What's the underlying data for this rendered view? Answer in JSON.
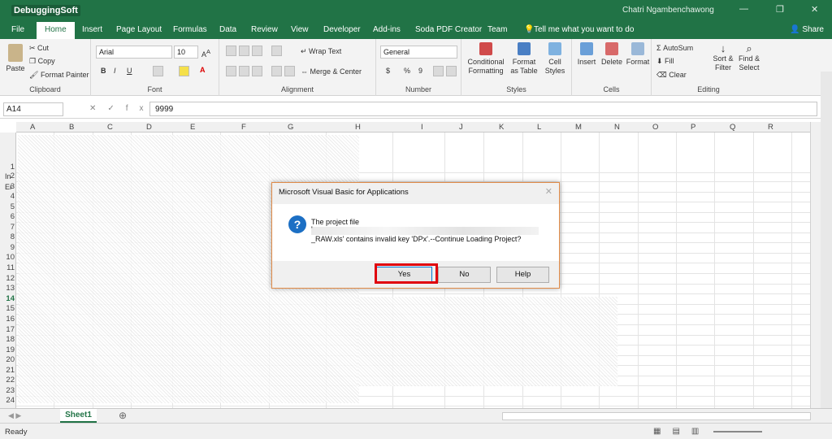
{
  "titlebar": {
    "logo": "DebuggingSoft",
    "user": "Chatri Ngambenchawong",
    "min": "—",
    "restore": "❐",
    "close": "✕"
  },
  "tabs": [
    {
      "label": "File",
      "active": false
    },
    {
      "label": "Home",
      "active": true
    },
    {
      "label": "Insert",
      "active": false
    },
    {
      "label": "Page Layout",
      "active": false
    },
    {
      "label": "Formulas",
      "active": false
    },
    {
      "label": "Data",
      "active": false
    },
    {
      "label": "Review",
      "active": false
    },
    {
      "label": "View",
      "active": false
    },
    {
      "label": "Developer",
      "active": false
    },
    {
      "label": "Add-ins",
      "active": false
    },
    {
      "label": "Soda PDF Creator",
      "active": false
    },
    {
      "label": "Team",
      "active": false
    },
    {
      "label": "Tell me what you want to do",
      "active": false
    }
  ],
  "share": "Share",
  "ribbon": {
    "clipboard": {
      "label": "Clipboard",
      "paste": "Paste",
      "cut": "Cut",
      "copy": "Copy",
      "format_painter": "Format Painter"
    },
    "font": {
      "label": "Font",
      "name": "Arial",
      "size": "10",
      "bold": "B",
      "italic": "I",
      "underline": "U"
    },
    "alignment": {
      "label": "Alignment",
      "wrap": "Wrap Text",
      "merge": "Merge & Center"
    },
    "number": {
      "label": "Number",
      "format": "General",
      "currency": "$",
      "percent": "%",
      "comma": "9"
    },
    "styles": {
      "label": "Styles",
      "conditional": "Conditional Formatting",
      "format_table": "Format as Table",
      "cell_styles": "Cell Styles"
    },
    "cells": {
      "label": "Cells",
      "insert": "Insert",
      "delete": "Delete",
      "format": "Format"
    },
    "editing": {
      "label": "Editing",
      "autosum": "AutoSum",
      "fill": "Fill",
      "clear": "Clear",
      "sort": "Sort & Filter",
      "find": "Find & Select"
    }
  },
  "formula_bar": {
    "name_box": "A14",
    "value": "9999"
  },
  "columns": [
    "A",
    "B",
    "C",
    "D",
    "E",
    "F",
    "G",
    "H",
    "I",
    "J",
    "K",
    "L",
    "M",
    "N",
    "O",
    "P",
    "Q",
    "R"
  ],
  "rows": [
    "1",
    "2",
    "3",
    "4",
    "5",
    "6",
    "7",
    "8",
    "9",
    "10",
    "11",
    "12",
    "13",
    "14",
    "15",
    "16",
    "17",
    "18",
    "19",
    "20",
    "21",
    "22",
    "23",
    "24"
  ],
  "cell_fragments": {
    "r2": "In",
    "r3": "Er"
  },
  "sheets": [
    {
      "label": "Sheet1",
      "active": true
    }
  ],
  "status": {
    "ready": "Ready"
  },
  "dialog": {
    "title": "Microsoft Visual Basic for Applications",
    "line1": "The project file",
    "line2": "'",
    "line3": "_RAW.xls' contains invalid key 'DPx'.--Continue Loading Project?",
    "yes": "Yes",
    "no": "No",
    "help": "Help",
    "icon": "?"
  },
  "accent": "#217346",
  "highlight_color": "#e0000b"
}
